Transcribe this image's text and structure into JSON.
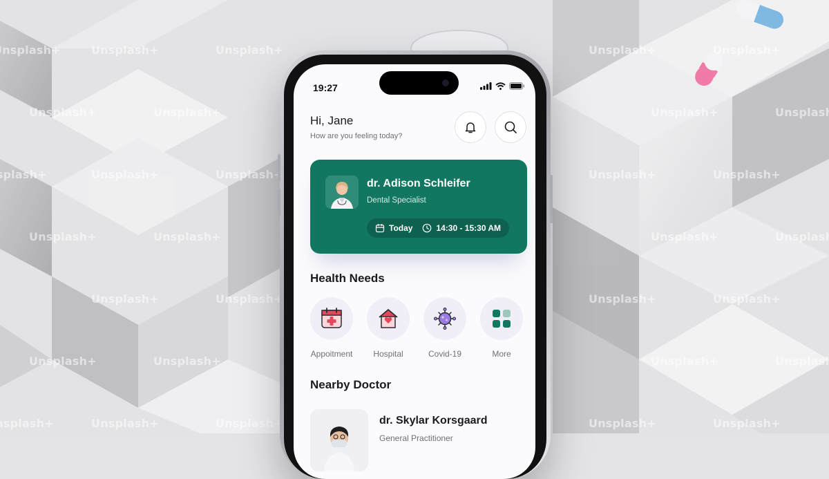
{
  "status_bar": {
    "time": "19:27"
  },
  "greeting": {
    "title": "Hi, Jane",
    "subtitle": "How are you feeling today?"
  },
  "header_actions": {
    "notification_icon": "bell-icon",
    "search_icon": "search-icon"
  },
  "appointment_card": {
    "doctor_name": "dr. Adison Schleifer",
    "specialty": "Dental Specialist",
    "date": "Today",
    "time_range": "14:30 - 15:30 AM",
    "background": "#127761"
  },
  "health_needs": {
    "title": "Health Needs",
    "items": [
      {
        "label": "Appoitment",
        "icon": "calendar-plus-icon"
      },
      {
        "label": "Hospital",
        "icon": "hospital-icon"
      },
      {
        "label": "Covid-19",
        "icon": "virus-icon"
      },
      {
        "label": "More",
        "icon": "grid-icon"
      }
    ]
  },
  "nearby_doctor": {
    "title": "Nearby Doctor",
    "doctor_name": "dr. Skylar Korsgaard",
    "specialty": "General Practitioner"
  },
  "watermark": {
    "text": "Unsplash+"
  },
  "colors": {
    "accent": "#127761",
    "icon_red": "#e04a5a",
    "icon_purple": "#9b7be0"
  }
}
